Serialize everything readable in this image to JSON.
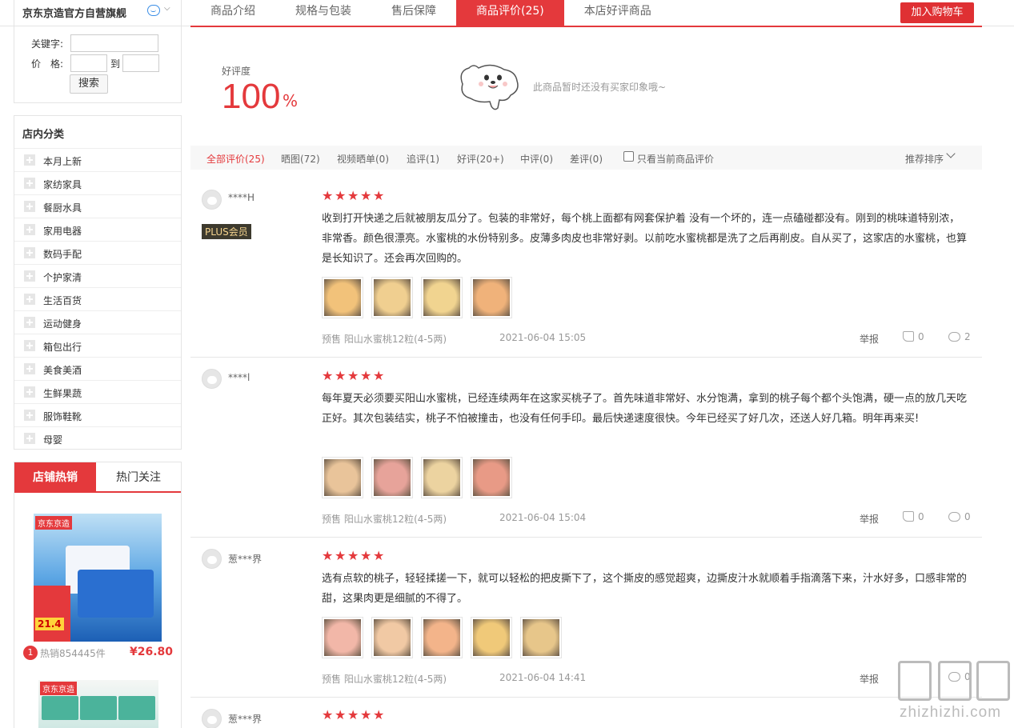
{
  "shop": {
    "name": "京东京造官方自营旗舰",
    "arrow": "⌵"
  },
  "tabs": [
    {
      "label": "商品介绍"
    },
    {
      "label": "规格与包装"
    },
    {
      "label": "售后保障"
    },
    {
      "label": "商品评价(25)"
    },
    {
      "label": "本店好评商品"
    }
  ],
  "cart_button": "加入购物车",
  "search": {
    "keyword_label": "关键字:",
    "price_label": "价　格:",
    "to_label": "到",
    "keyword_value": "",
    "price_min": "",
    "price_max": "",
    "button": "搜索"
  },
  "categories": {
    "title": "店内分类",
    "items": [
      "本月上新",
      "家纺家具",
      "餐厨水具",
      "家用电器",
      "数码手配",
      "个护家清",
      "生活百货",
      "运动健身",
      "箱包出行",
      "美食美酒",
      "生鲜果蔬",
      "服饰鞋靴",
      "母婴"
    ]
  },
  "hot": {
    "tab_active": "店铺热销",
    "tab_inactive": "热门关注",
    "item1": {
      "rank": "1",
      "sales": "热销854445件",
      "price": "¥26.80",
      "logo": "京东京造",
      "price_tag": "21.4"
    },
    "item2": {
      "logo": "京东京造"
    }
  },
  "rating": {
    "label": "好评度",
    "value": "100",
    "unit": "%",
    "no_impression": "此商品暂时还没有买家印象哦~"
  },
  "filters": {
    "items": [
      "全部评价(25)",
      "晒图(72)",
      "视频晒单(0)",
      "追评(1)",
      "好评(20+)",
      "中评(0)",
      "差评(0)"
    ],
    "only_current": "只看当前商品评价",
    "sort": "推荐排序"
  },
  "reviews": [
    {
      "user": "****H",
      "badge": "PLUS会员",
      "stars": 5,
      "text": "收到打开快递之后就被朋友瓜分了。包装的非常好，每个桃上面都有网套保护着 没有一个坏的，连一点磕碰都没有。刚到的桃味道特别浓，非常香。颜色很漂亮。水蜜桃的水份特别多。皮薄多肉皮也非常好剥。以前吃水蜜桃都是洗了之后再削皮。自从买了，这家店的水蜜桃，也算是长知识了。还会再次回购的。",
      "product": "预售 阳山水蜜桃12粒(4-5两)",
      "time": "2021-06-04 15:05",
      "report": "举报",
      "likes": "0",
      "comments": "2",
      "thumbs": [
        "#f2c27a",
        "#f0cf90",
        "#f1d490",
        "#f0b27a"
      ]
    },
    {
      "user": "****l",
      "badge": "",
      "stars": 5,
      "text": "每年夏天必须要买阳山水蜜桃，已经连续两年在这家买桃子了。首先味道非常好、水分饱满，拿到的桃子每个都个头饱满，硬一点的放几天吃正好。其次包装结实，桃子不怕被撞击，也没有任何手印。最后快递速度很快。今年已经买了好几次，还送人好几箱。明年再来买!",
      "product": "预售 阳山水蜜桃12粒(4-5两)",
      "time": "2021-06-04 15:04",
      "report": "举报",
      "likes": "0",
      "comments": "0",
      "thumbs": [
        "#e9c49a",
        "#e7a39a",
        "#ecd3a0",
        "#e89a86"
      ]
    },
    {
      "user": "葱***界",
      "badge": "",
      "stars": 5,
      "text": "选有点软的桃子，轻轻揉搓一下，就可以轻松的把皮撕下了，这个撕皮的感觉超爽，边撕皮汁水就顺着手指滴落下来，汁水好多，口感非常的甜，这果肉更是细腻的不得了。",
      "product": "预售 阳山水蜜桃12粒(4-5两)",
      "time": "2021-06-04 14:41",
      "report": "举报",
      "likes": "",
      "comments": "0",
      "thumbs": [
        "#f2b7a8",
        "#f1c9a4",
        "#f3b48a",
        "#f0c979",
        "#e7c68a"
      ]
    },
    {
      "user": "葱***界",
      "stars": 5
    }
  ],
  "watermark": {
    "text": "zhizhizhi.com"
  },
  "colors": {
    "accent": "#e4393c",
    "text": "#333333",
    "muted": "#999999"
  }
}
